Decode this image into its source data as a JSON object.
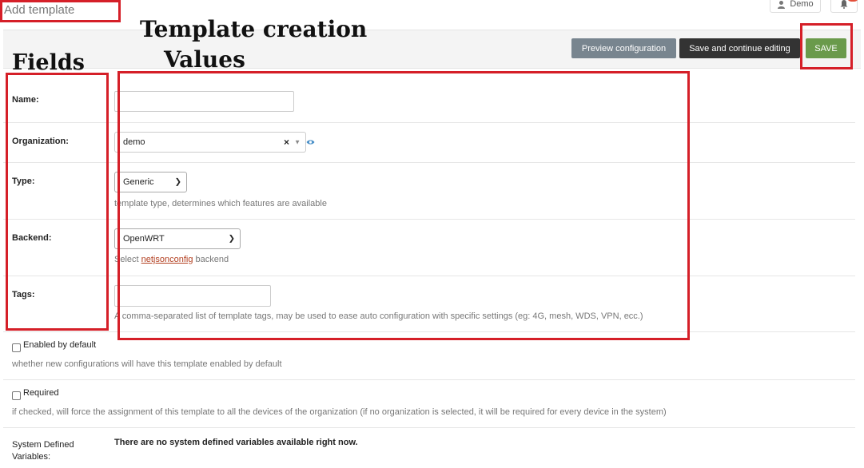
{
  "header": {
    "page_title": "Add template",
    "user_label": "Demo"
  },
  "toolbar": {
    "preview_label": "Preview configuration",
    "continue_label": "Save and continue editing",
    "save_label": "SAVE"
  },
  "annotations": {
    "template_creation": "Template creation",
    "values": "Values",
    "fields": "Fields"
  },
  "form": {
    "name_label": "Name:",
    "name_value": "",
    "organization_label": "Organization:",
    "organization_value": "demo",
    "organization_clear": "×",
    "type_label": "Type:",
    "type_value": "Generic",
    "type_help": "template type, determines which features are available",
    "backend_label": "Backend:",
    "backend_value": "OpenWRT",
    "backend_help_prefix": "Select",
    "backend_help_link": "netjsonconfig",
    "backend_help_suffix": "backend",
    "tags_label": "Tags:",
    "tags_value": "",
    "tags_help": "A comma-separated list of template tags, may be used to ease auto configuration with specific settings (eg: 4G, mesh, WDS, VPN, ecc.)",
    "default_label": "Enabled by default",
    "default_help": "whether new configurations will have this template enabled by default",
    "required_label": "Required",
    "required_help": "if checked, will force the assignment of this template to all the devices of the organization (if no organization is selected, it will be required for every device in the system)",
    "system_vars_label_line1": "System Defined",
    "system_vars_label_line2": "Variables:",
    "system_vars_value": "There are no system defined variables available right now."
  },
  "colors": {
    "annotation_red": "#d51f28",
    "save_green": "#6a9a4b",
    "preview_gray": "#78858f",
    "continue_dark": "#333333",
    "link": "#b23e1f"
  }
}
